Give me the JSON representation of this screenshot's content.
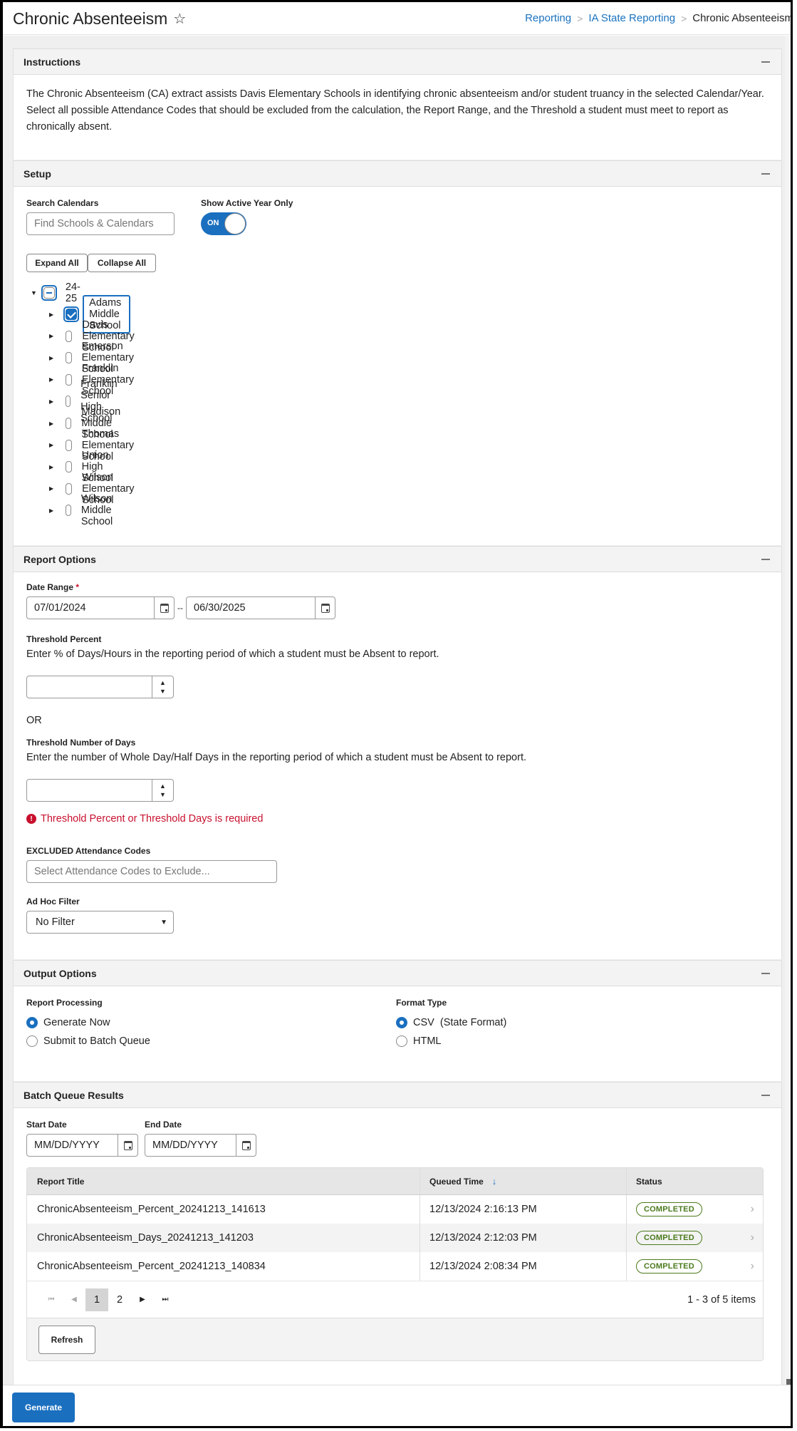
{
  "header": {
    "title": "Chronic Absenteeism",
    "favorite_icon": "star-outline-icon",
    "breadcrumb": [
      "Reporting",
      "IA State Reporting",
      "Chronic Absenteeism"
    ]
  },
  "instructions": {
    "title": "Instructions",
    "text": "The Chronic Absenteeism (CA) extract assists Davis Elementary Schools in identifying chronic absenteeism and/or student truancy in the selected Calendar/Year. Select all possible Attendance Codes that should be excluded from the calculation, the Report Range, and the Threshold a student must meet to report as chronically absent."
  },
  "setup": {
    "title": "Setup",
    "search_label": "Search Calendars",
    "search_placeholder": "Find Schools & Calendars",
    "active_year_label": "Show Active Year Only",
    "active_year_toggle": "ON",
    "expand_all": "Expand All",
    "collapse_all": "Collapse All",
    "year": {
      "label": "24-25",
      "state": "partial",
      "expanded": true
    },
    "schools": [
      {
        "name": "Adams Middle School",
        "checked": true
      },
      {
        "name": "Davis Elementary School",
        "checked": false
      },
      {
        "name": "Emerson Elementary School",
        "checked": false
      },
      {
        "name": "Franklin Elementary School",
        "checked": false
      },
      {
        "name": "Franklin Senior High School",
        "checked": false
      },
      {
        "name": "Madison Middle School",
        "checked": false
      },
      {
        "name": "Thomas Elementary School",
        "checked": false
      },
      {
        "name": "Union High School",
        "checked": false
      },
      {
        "name": "Wilson Elementary School",
        "checked": false
      },
      {
        "name": "Wilson Middle School",
        "checked": false
      }
    ]
  },
  "report_options": {
    "title": "Report Options",
    "date_range_label": "Date Range",
    "required_mark": "*",
    "start_date": "07/01/2024",
    "date_separator": "--",
    "end_date": "06/30/2025",
    "threshold_percent_label": "Threshold Percent",
    "threshold_percent_help": "Enter % of Days/Hours in the reporting period of which a student must be Absent to report.",
    "threshold_percent_value": "",
    "or_text": "OR",
    "threshold_days_label": "Threshold Number of Days",
    "threshold_days_help": "Enter the number of Whole Day/Half Days in the reporting period of which a student must be Absent to report.",
    "threshold_days_value": "",
    "error_message": "Threshold Percent or Threshold Days is required",
    "excluded_codes_label": "EXCLUDED Attendance Codes",
    "excluded_codes_placeholder": "Select Attendance Codes to Exclude...",
    "adhoc_label": "Ad Hoc Filter",
    "adhoc_value": "No Filter"
  },
  "output_options": {
    "title": "Output Options",
    "processing_label": "Report Processing",
    "processing_options": [
      {
        "label": "Generate Now",
        "selected": true
      },
      {
        "label": "Submit to Batch Queue",
        "selected": false
      }
    ],
    "format_label": "Format Type",
    "format_options": [
      {
        "label": "CSV  (State Format)",
        "selected": true
      },
      {
        "label": "HTML",
        "selected": false
      }
    ]
  },
  "batch_queue": {
    "title": "Batch Queue Results",
    "start_date_label": "Start Date",
    "start_date_placeholder": "MM/DD/YYYY",
    "end_date_label": "End Date",
    "end_date_placeholder": "MM/DD/YYYY",
    "columns": [
      "Report Title",
      "Queued Time",
      "Status"
    ],
    "sort_indicator": "↓",
    "rows": [
      {
        "title": "ChronicAbsenteeism_Percent_20241213_141613",
        "time": "12/13/2024 2:16:13 PM",
        "status": "COMPLETED"
      },
      {
        "title": "ChronicAbsenteeism_Days_20241213_141203",
        "time": "12/13/2024 2:12:03 PM",
        "status": "COMPLETED"
      },
      {
        "title": "ChronicAbsenteeism_Percent_20241213_140834",
        "time": "12/13/2024 2:08:34 PM",
        "status": "COMPLETED"
      }
    ],
    "pager": {
      "pages": [
        "1",
        "2"
      ],
      "current": "1",
      "summary": "1 - 3 of 5 items"
    },
    "refresh_label": "Refresh"
  },
  "footer": {
    "generate_label": "Generate"
  },
  "colors": {
    "accent": "#1a6fbf",
    "error": "#c8102e",
    "success": "#4a7a1c"
  }
}
